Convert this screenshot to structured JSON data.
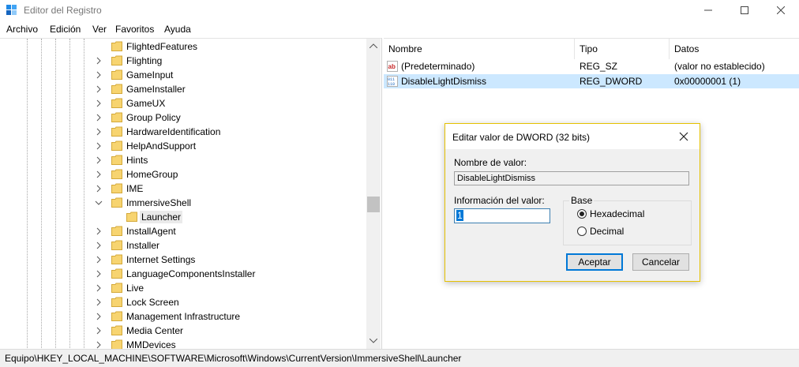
{
  "window": {
    "title": "Editor del Registro",
    "colors": {
      "accent": "#0078d7",
      "selection": "#cce8ff",
      "dialog_border": "#e5c100",
      "folder": "#f7d470"
    }
  },
  "menu": [
    "Archivo",
    "Edición",
    "Ver",
    "Favoritos",
    "Ayuda"
  ],
  "tree": {
    "items": [
      {
        "label": "FlightedFeatures",
        "expander": false
      },
      {
        "label": "Flighting",
        "expander": true
      },
      {
        "label": "GameInput",
        "expander": true
      },
      {
        "label": "GameInstaller",
        "expander": true
      },
      {
        "label": "GameUX",
        "expander": true
      },
      {
        "label": "Group Policy",
        "expander": true
      },
      {
        "label": "HardwareIdentification",
        "expander": true
      },
      {
        "label": "HelpAndSupport",
        "expander": true
      },
      {
        "label": "Hints",
        "expander": true
      },
      {
        "label": "HomeGroup",
        "expander": true
      },
      {
        "label": "IME",
        "expander": true
      },
      {
        "label": "ImmersiveShell",
        "expander": true,
        "expanded": true
      },
      {
        "label": "Launcher",
        "child": true,
        "selected": true
      },
      {
        "label": "InstallAgent",
        "expander": true
      },
      {
        "label": "Installer",
        "expander": true
      },
      {
        "label": "Internet Settings",
        "expander": true
      },
      {
        "label": "LanguageComponentsInstaller",
        "expander": true
      },
      {
        "label": "Live",
        "expander": true
      },
      {
        "label": "Lock Screen",
        "expander": true
      },
      {
        "label": "Management Infrastructure",
        "expander": true
      },
      {
        "label": "Media Center",
        "expander": true
      },
      {
        "label": "MMDevices",
        "expander": true
      }
    ]
  },
  "values": {
    "headers": {
      "name": "Nombre",
      "type": "Tipo",
      "data": "Datos"
    },
    "rows": [
      {
        "icon": "string-value-icon",
        "name": "(Predeterminado)",
        "type": "REG_SZ",
        "data": "(valor no establecido)",
        "selected": false
      },
      {
        "icon": "dword-value-icon",
        "name": "DisableLightDismiss",
        "type": "REG_DWORD",
        "data": "0x00000001 (1)",
        "selected": true
      }
    ]
  },
  "status": {
    "path": "Equipo\\HKEY_LOCAL_MACHINE\\SOFTWARE\\Microsoft\\Windows\\CurrentVersion\\ImmersiveShell\\Launcher"
  },
  "dialog": {
    "title": "Editar valor de DWORD (32 bits)",
    "name_label": "Nombre de valor:",
    "name_value": "DisableLightDismiss",
    "data_label": "Información del valor:",
    "data_value": "1",
    "base_label": "Base",
    "base_options": [
      "Hexadecimal",
      "Decimal"
    ],
    "base_selected": "Hexadecimal",
    "ok_label": "Aceptar",
    "cancel_label": "Cancelar"
  }
}
